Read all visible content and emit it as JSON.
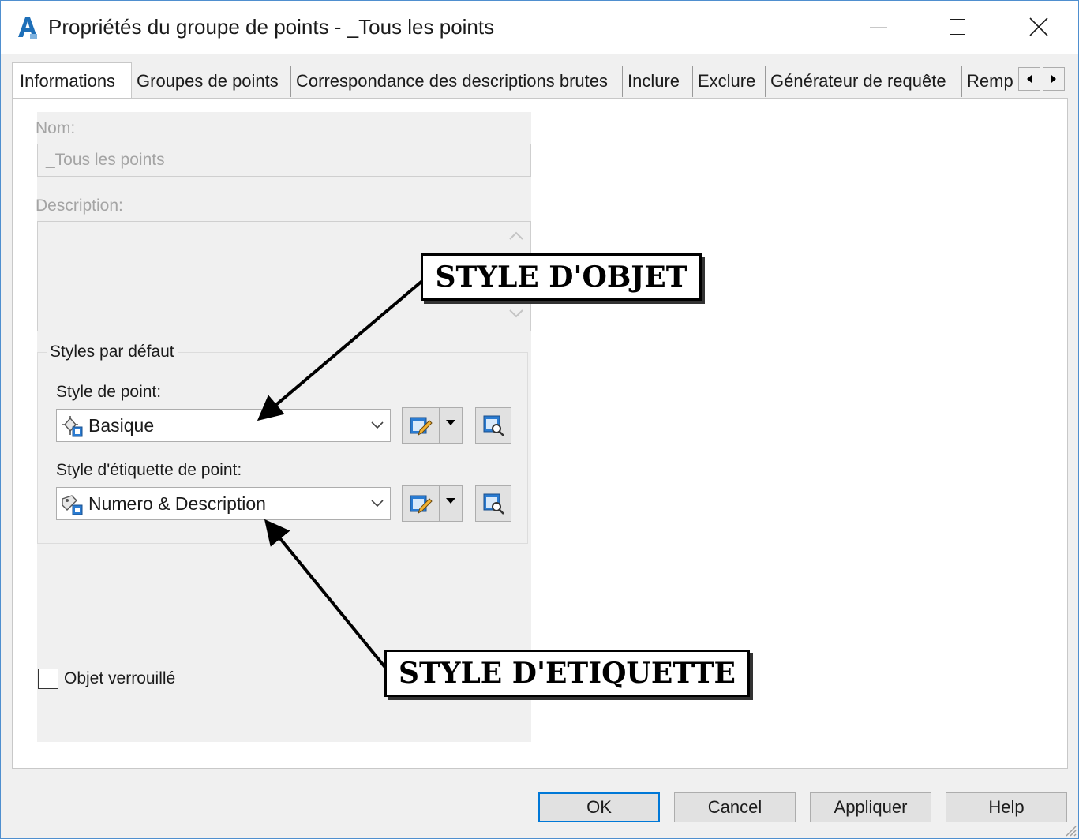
{
  "window": {
    "title": "Propriétés du groupe de points - _Tous les points",
    "accent": "#0078d7"
  },
  "tabs": [
    {
      "label": "Informations",
      "active": true
    },
    {
      "label": "Groupes de points"
    },
    {
      "label": "Correspondance des descriptions brutes"
    },
    {
      "label": "Inclure"
    },
    {
      "label": "Exclure"
    },
    {
      "label": "Générateur de requête"
    },
    {
      "label": "Remp"
    }
  ],
  "info": {
    "name_label": "Nom:",
    "name_value": "_Tous les points",
    "description_label": "Description:",
    "description_value": "",
    "group_title": "Styles par défaut",
    "point_style_label": "Style de point:",
    "point_style_value": "Basique",
    "label_style_label": "Style d'étiquette de point:",
    "label_style_value": "Numero & Description",
    "locked_label": "Objet verrouillé",
    "locked_checked": false
  },
  "footer": {
    "ok": "OK",
    "cancel": "Cancel",
    "apply": "Appliquer",
    "help": "Help"
  },
  "annotations": {
    "object_style": "STYLE D'OBJET",
    "label_style": "STYLE D'ETIQUETTE"
  }
}
